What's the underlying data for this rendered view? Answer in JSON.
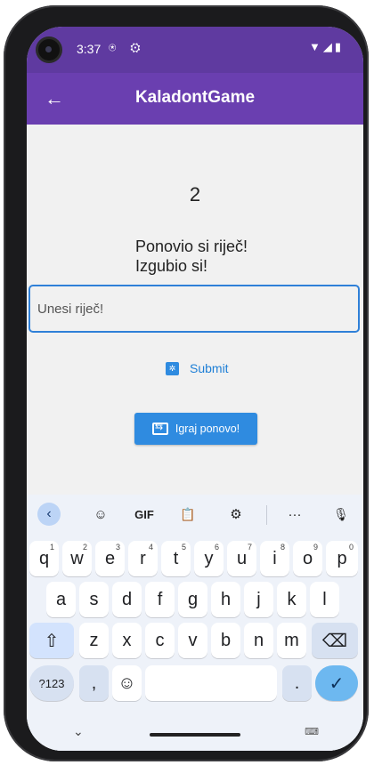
{
  "status_bar": {
    "time": "3:37",
    "left_icons": [
      "location-icon",
      "settings-icon"
    ],
    "left_icon_glyphs": "⍟ ⚙",
    "right_icon_glyphs": "▼◢▮"
  },
  "app_bar": {
    "title": "KaladontGame",
    "back_glyph": "←",
    "background_color": "#6a3fb0"
  },
  "game": {
    "score": "2",
    "message_line1": "Ponovio si riječ!",
    "message_line2": "Izgubio si!"
  },
  "input": {
    "value": "",
    "placeholder": "Unesi riječ!"
  },
  "buttons": {
    "submit_label": "Submit",
    "replay_label": "Igraj ponovo!",
    "accent_color": "#2f8be0"
  },
  "keyboard": {
    "toolbar": {
      "collapse": "‹",
      "sticker": "☺",
      "gif": "GIF",
      "clipboard": "📋",
      "settings": "⚙",
      "more": "···",
      "mic": "🎙"
    },
    "row1": [
      {
        "key": "q",
        "hint": "1"
      },
      {
        "key": "w",
        "hint": "2"
      },
      {
        "key": "e",
        "hint": "3"
      },
      {
        "key": "r",
        "hint": "4"
      },
      {
        "key": "t",
        "hint": "5"
      },
      {
        "key": "y",
        "hint": "6"
      },
      {
        "key": "u",
        "hint": "7"
      },
      {
        "key": "i",
        "hint": "8"
      },
      {
        "key": "o",
        "hint": "9"
      },
      {
        "key": "p",
        "hint": "0"
      }
    ],
    "row2": [
      "a",
      "s",
      "d",
      "f",
      "g",
      "h",
      "j",
      "k",
      "l"
    ],
    "row3": [
      "z",
      "x",
      "c",
      "v",
      "b",
      "n",
      "m"
    ],
    "shift": "⇧",
    "backspace": "⌫",
    "symbols": "?123",
    "comma": ",",
    "emoji": "☺",
    "space": "",
    "period": ".",
    "enter": "✓",
    "nav_chevron": "⌄",
    "kb_switch": "⌨"
  }
}
